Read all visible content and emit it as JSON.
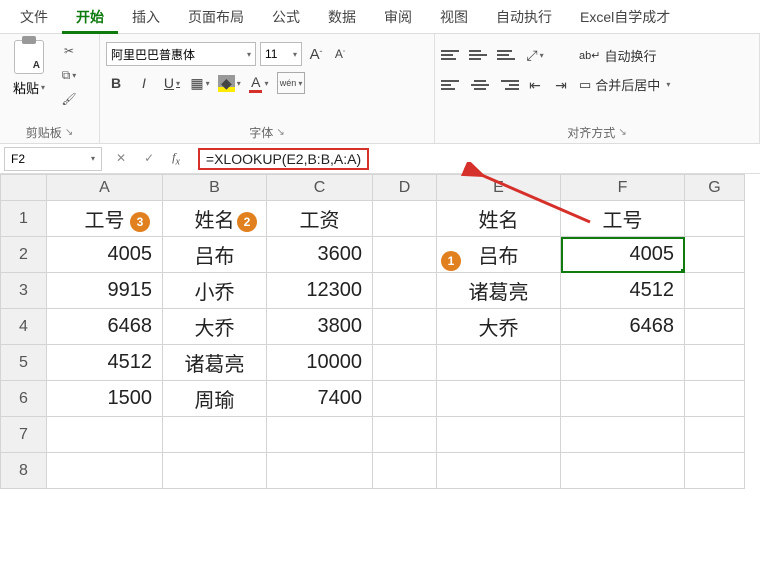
{
  "tabs": {
    "file": "文件",
    "home": "开始",
    "insert": "插入",
    "layout": "页面布局",
    "formula": "公式",
    "data": "数据",
    "review": "审阅",
    "view": "视图",
    "auto": "自动执行",
    "custom": "Excel自学成才"
  },
  "ribbon": {
    "paste_label": "粘贴",
    "clipboard_group": "剪贴板",
    "font_name": "阿里巴巴普惠体",
    "font_size": "11",
    "bold": "B",
    "italic": "I",
    "underline": "U",
    "font_color_letter": "A",
    "phonetic": "wén",
    "font_group": "字体",
    "wrap_text": "自动换行",
    "merge_center": "合并后居中",
    "align_group": "对齐方式",
    "increase_a": "A",
    "decrease_a": "A"
  },
  "namebox": "F2",
  "formula": "=XLOOKUP(E2,B:B,A:A)",
  "headers": {
    "A": "A",
    "B": "B",
    "C": "C",
    "D": "D",
    "E": "E",
    "F": "F",
    "G": "G"
  },
  "badges": {
    "b1": "1",
    "b2": "2",
    "b3": "3"
  },
  "chart_data": {
    "type": "table",
    "left_table": {
      "columns": [
        "工号",
        "姓名",
        "工资"
      ],
      "rows": [
        [
          4005,
          "吕布",
          3600
        ],
        [
          9915,
          "小乔",
          12300
        ],
        [
          6468,
          "大乔",
          3800
        ],
        [
          4512,
          "诸葛亮",
          10000
        ],
        [
          1500,
          "周瑜",
          7400
        ]
      ]
    },
    "right_table": {
      "columns": [
        "姓名",
        "工号"
      ],
      "rows": [
        [
          "吕布",
          4005
        ],
        [
          "诸葛亮",
          4512
        ],
        [
          "大乔",
          6468
        ]
      ]
    }
  }
}
